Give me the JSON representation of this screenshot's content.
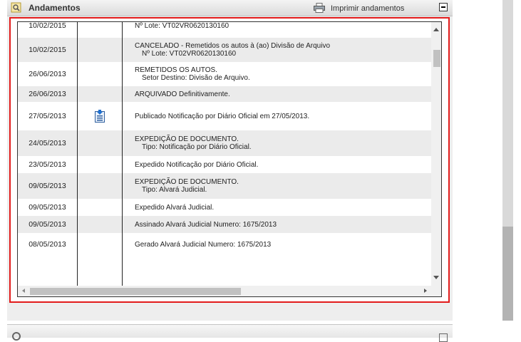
{
  "panel": {
    "title": "Andamentos",
    "print_label": "Imprimir andamentos"
  },
  "rows": [
    {
      "date": "10/02/2015",
      "has_doc": false,
      "lines": [
        "Nº Lote: VT02VR0620130160"
      ],
      "shade": "wht"
    },
    {
      "date": "10/02/2015",
      "has_doc": false,
      "lines": [
        "CANCELADO - Remetidos os autos à (ao) Divisão de Arquivo",
        "Nº Lote: VT02VR0620130160"
      ],
      "shade": "alt"
    },
    {
      "date": "26/06/2013",
      "has_doc": false,
      "lines": [
        "REMETIDOS OS AUTOS.",
        "Setor Destino: Divisão de Arquivo."
      ],
      "shade": "wht"
    },
    {
      "date": "26/06/2013",
      "has_doc": false,
      "lines": [
        "ARQUIVADO Definitivamente."
      ],
      "shade": "alt"
    },
    {
      "date": "27/05/2013",
      "has_doc": true,
      "lines": [
        "Publicado Notificação por Diário Oficial em 27/05/2013."
      ],
      "shade": "wht"
    },
    {
      "date": "24/05/2013",
      "has_doc": false,
      "lines": [
        "EXPEDIÇÃO DE DOCUMENTO.",
        "Tipo: Notificação por Diário Oficial."
      ],
      "shade": "alt"
    },
    {
      "date": "23/05/2013",
      "has_doc": false,
      "lines": [
        "Expedido Notificação por Diário Oficial."
      ],
      "shade": "wht"
    },
    {
      "date": "09/05/2013",
      "has_doc": false,
      "lines": [
        "EXPEDIÇÃO DE DOCUMENTO.",
        "Tipo: Alvará Judicial."
      ],
      "shade": "alt"
    },
    {
      "date": "09/05/2013",
      "has_doc": false,
      "lines": [
        "Expedido Alvará Judicial."
      ],
      "shade": "wht"
    },
    {
      "date": "09/05/2013",
      "has_doc": false,
      "lines": [
        "Assinado Alvará Judicial Numero: 1675/2013"
      ],
      "shade": "alt"
    },
    {
      "date": "08/05/2013",
      "has_doc": false,
      "lines": [
        "Gerado Alvará Judicial Numero: 1675/2013"
      ],
      "shade": "wht"
    }
  ],
  "icons": {
    "header": "magnifier-document-icon",
    "print": "printer-icon",
    "minimize": "minimize-icon",
    "doc": "document-download-icon"
  },
  "colors": {
    "frame": "#e21b1b",
    "row_alt": "#ebebeb"
  }
}
